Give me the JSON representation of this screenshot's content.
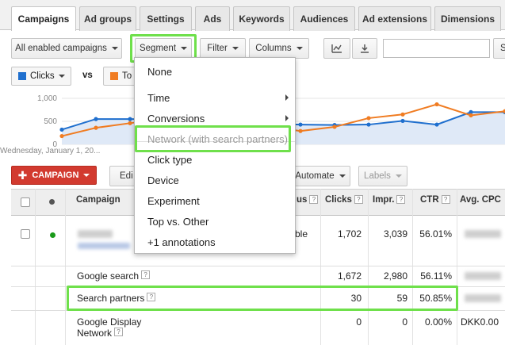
{
  "tabs": [
    "Campaigns",
    "Ad groups",
    "Settings",
    "Ads",
    "Keywords",
    "Audiences",
    "Ad extensions",
    "Dimensions"
  ],
  "toolbar": {
    "filter_all": "All enabled campaigns",
    "segment": "Segment",
    "filter": "Filter",
    "columns": "Columns",
    "search_cut": "S"
  },
  "legend": {
    "metric1": "Clicks",
    "vs": "vs",
    "metric2_cut": "To",
    "color1": "#1f6fce",
    "color2": "#f07c22"
  },
  "chart_data": {
    "type": "line",
    "y_ticks": [
      "1,000",
      "500",
      "0"
    ],
    "ylim": [
      0,
      1000
    ],
    "x_label_start": "Wednesday, January 1, 20...",
    "x": [
      0,
      1,
      2,
      3,
      4,
      5,
      6,
      7,
      8,
      9,
      10,
      11,
      12,
      13
    ],
    "series": [
      {
        "values": [
          320,
          550,
          550,
          540,
          520,
          440,
          430,
          430,
          420,
          430,
          510,
          430,
          700,
          700
        ]
      },
      {
        "values": [
          180,
          360,
          460,
          560,
          580,
          560,
          400,
          290,
          380,
          570,
          650,
          870,
          630,
          720
        ]
      }
    ]
  },
  "actions": {
    "campaign": "CAMPAIGN",
    "edit_cut": "Edi",
    "automate": "Automate",
    "labels": "Labels"
  },
  "table": {
    "headers": {
      "campaign": "Campaign",
      "status_cut": "us",
      "clicks": "Clicks",
      "impr": "Impr.",
      "ctr": "CTR",
      "avg_cpc": "Avg. CPC"
    },
    "qmark": "?",
    "rows": [
      {
        "status_cut": "ble",
        "clicks": "1,702",
        "impr": "3,039",
        "ctr": "56.01%"
      },
      {
        "name": "Google search",
        "clicks": "1,672",
        "impr": "2,980",
        "ctr": "56.11%"
      },
      {
        "name": "Search partners",
        "clicks": "30",
        "impr": "59",
        "ctr": "50.85%"
      },
      {
        "name_line1": "Google Display",
        "name_line2": "Network",
        "clicks": "0",
        "impr": "0",
        "ctr": "0.00%",
        "cpc": "DKK0.00"
      }
    ]
  },
  "segment_menu": {
    "items": [
      "None",
      "Time",
      "Conversions",
      "Network (with search partners)",
      "Click type",
      "Device",
      "Experiment",
      "Top vs. Other",
      "+1 annotations"
    ]
  },
  "highlight_color": "#6fe04b"
}
